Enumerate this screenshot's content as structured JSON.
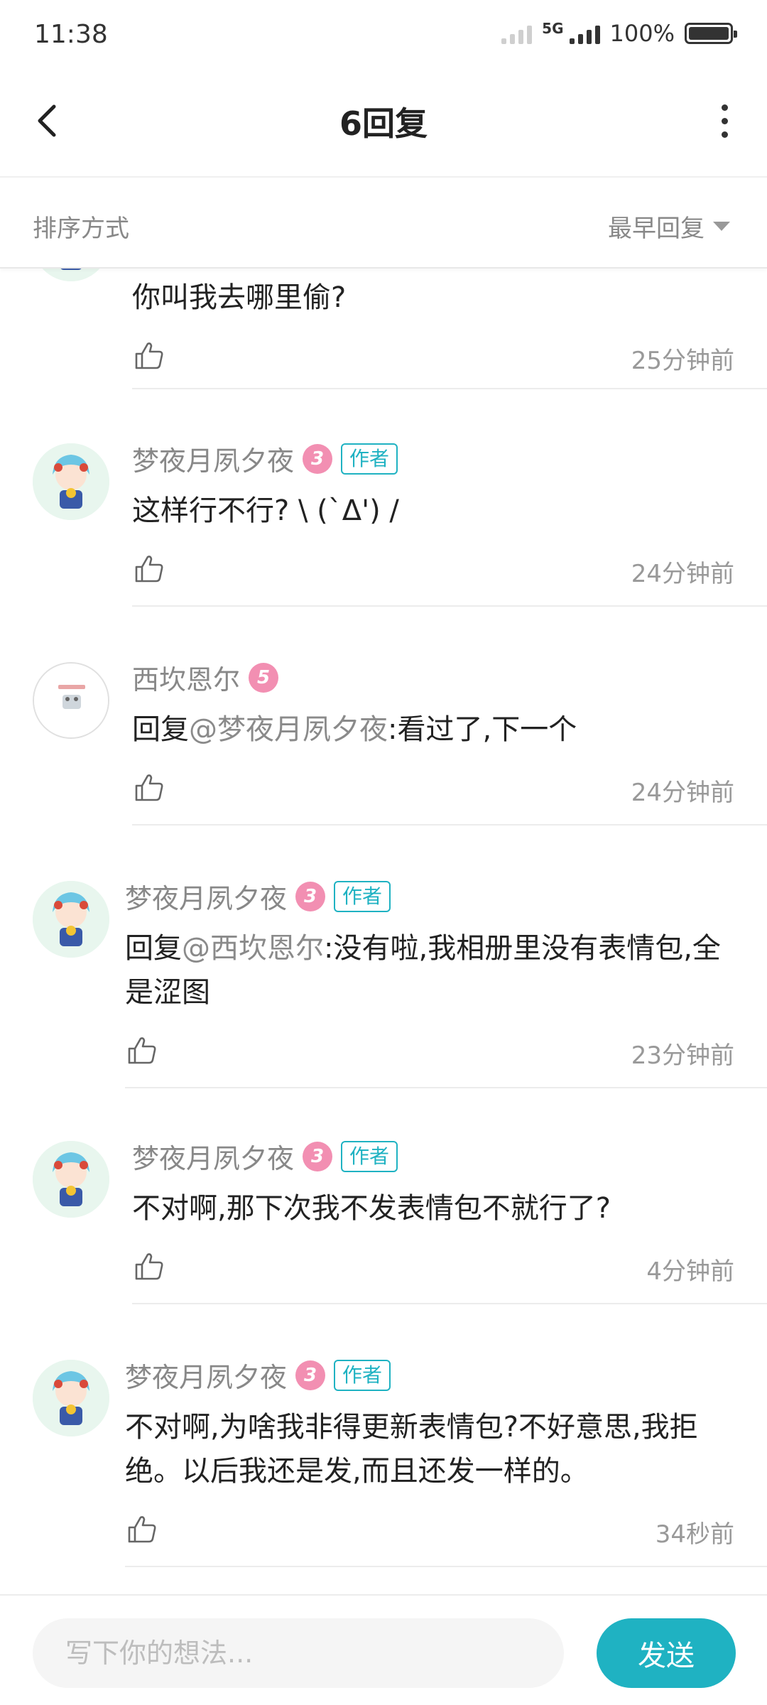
{
  "status_bar": {
    "time": "11:38",
    "network": "5G",
    "battery": "100%",
    "battery_level": 1.0
  },
  "header": {
    "title": "6回复"
  },
  "sort": {
    "label": "排序方式",
    "value": "最早回复"
  },
  "comments": [
    {
      "name": "",
      "level": "",
      "text": "你叫我去哪里偷?",
      "time": "25分钟前"
    },
    {
      "name": "梦夜月夙夕夜",
      "level": "3",
      "badge": "作者",
      "text": "这样行不行? \\ (`Δ') /",
      "time": "24分钟前"
    },
    {
      "name": "西坎恩尔",
      "level": "5",
      "reply_prefix": "回复",
      "mention": "@梦夜月夙夕夜",
      "text": ":看过了,下一个",
      "time": "24分钟前"
    },
    {
      "name": "梦夜月夙夕夜",
      "level": "3",
      "badge": "作者",
      "reply_prefix": "回复",
      "mention": "@西坎恩尔",
      "text": ":没有啦,我相册里没有表情包,全是涩图",
      "time": "23分钟前"
    },
    {
      "name": "梦夜月夙夕夜",
      "level": "3",
      "badge": "作者",
      "text": "不对啊,那下次我不发表情包不就行了?",
      "time": "4分钟前"
    },
    {
      "name": "梦夜月夙夕夜",
      "level": "3",
      "badge": "作者",
      "text": "不对啊,为啥我非得更新表情包?不好意思,我拒绝。以后我还是发,而且还发一样的。",
      "time": "34秒前"
    }
  ],
  "composer": {
    "placeholder": "写下你的想法...",
    "send_label": "发送"
  },
  "colors": {
    "accent": "#1fb2c2",
    "level_badge": "#f28fb2"
  }
}
